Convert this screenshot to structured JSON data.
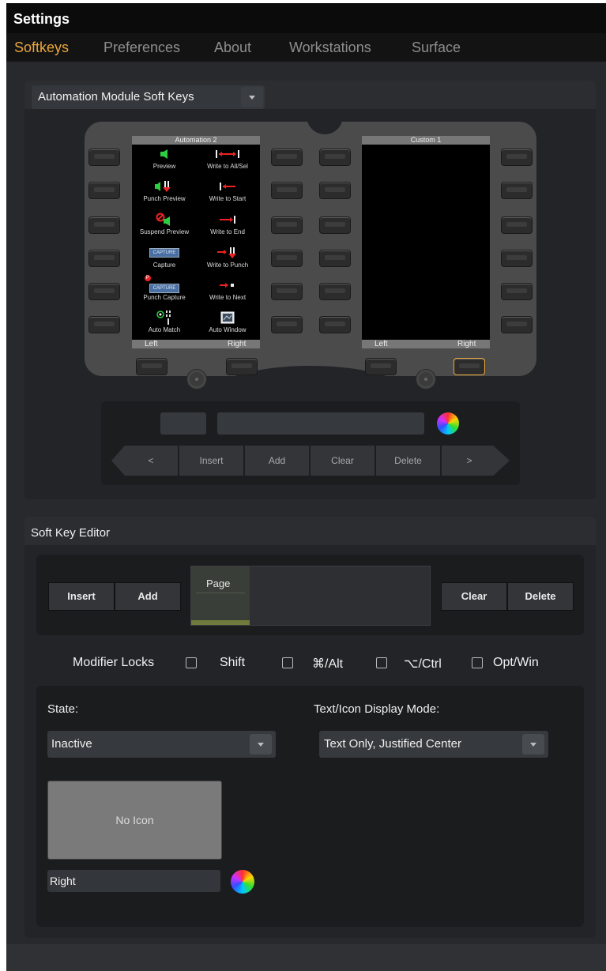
{
  "window": {
    "title": "Settings"
  },
  "tabs": [
    {
      "label": "Softkeys",
      "active": true
    },
    {
      "label": "Preferences"
    },
    {
      "label": "About"
    },
    {
      "label": "Workstations"
    },
    {
      "label": "Surface"
    }
  ],
  "module_select": {
    "value": "Automation Module Soft Keys"
  },
  "left_screen": {
    "title": "Automation 2",
    "cells": [
      {
        "label": "Preview",
        "icon": "speaker-icon"
      },
      {
        "label": "Write to All/Sel",
        "icon": "write-all-icon"
      },
      {
        "label": "Punch Preview",
        "icon": "punch-preview-icon"
      },
      {
        "label": "Write to Start",
        "icon": "write-start-icon"
      },
      {
        "label": "Suspend Preview",
        "icon": "suspend-preview-icon"
      },
      {
        "label": "Write to End",
        "icon": "write-end-icon"
      },
      {
        "label": "Capture",
        "icon": "capture-icon",
        "badge": "CAPTURE"
      },
      {
        "label": "Write to Punch",
        "icon": "write-punch-icon"
      },
      {
        "label": "Punch Capture",
        "icon": "punch-capture-icon",
        "badge": "CAPTURE"
      },
      {
        "label": "Write to Next",
        "icon": "write-next-icon"
      },
      {
        "label": "Auto Match",
        "icon": "auto-match-icon"
      },
      {
        "label": "Auto Window",
        "icon": "auto-window-icon"
      }
    ],
    "footer_left": "Left",
    "footer_right": "Right"
  },
  "right_screen": {
    "title": "Custom 1",
    "footer_left": "Left",
    "footer_right": "Right"
  },
  "nav": {
    "prev": "<",
    "insert": "Insert",
    "add": "Add",
    "clear": "Clear",
    "delete": "Delete",
    "next": ">"
  },
  "editor": {
    "title": "Soft Key Editor",
    "insert": "Insert",
    "add": "Add",
    "page_label": "Page",
    "clear": "Clear",
    "delete": "Delete",
    "modifier_locks": "Modifier Locks",
    "modifiers": [
      {
        "label": "Shift"
      },
      {
        "label": "⌘/Alt"
      },
      {
        "label": "⌥/Ctrl"
      },
      {
        "label": "Opt/Win"
      }
    ],
    "state_label": "State:",
    "state_value": "Inactive",
    "display_mode_label": "Text/Icon Display Mode:",
    "display_mode_value": "Text Only, Justified Center",
    "icon_preview": "No Icon",
    "key_text": "Right"
  },
  "colors": {
    "accent": "#e9a63c",
    "background": "#27292c",
    "panel": "#222427"
  }
}
